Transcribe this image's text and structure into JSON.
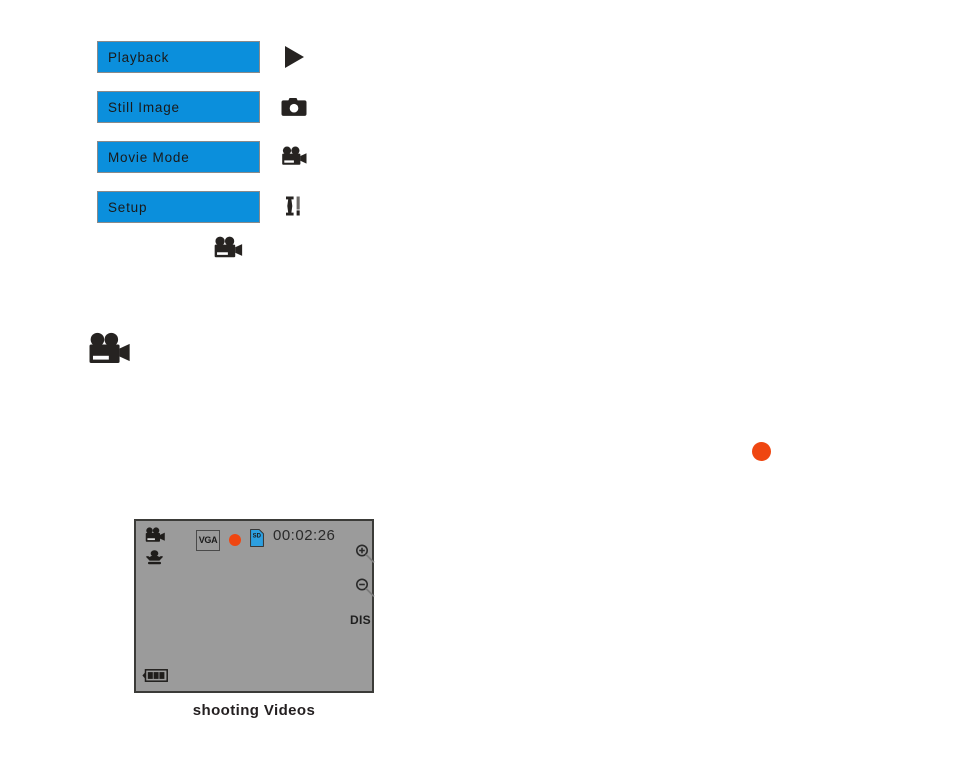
{
  "mode_menu": {
    "items": [
      {
        "label": "Playback",
        "icon": "play-triangle-icon"
      },
      {
        "label": "Still Image",
        "icon": "still-camera-icon"
      },
      {
        "label": "Movie Mode",
        "icon": "camcorder-icon"
      },
      {
        "label": "Setup",
        "icon": "tools-wrench-icon"
      }
    ],
    "trailing_icon": "camcorder-icon"
  },
  "large_icon": {
    "name": "camcorder-icon"
  },
  "record_indicator": {
    "name": "record-dot",
    "color": "#ef4611"
  },
  "lcd": {
    "mode_icon": "camcorder-icon",
    "macro_icon": "macro-flower-icon",
    "quality_badge": "VGA",
    "record_dot": "record-dot",
    "record_dot_color": "#ef4611",
    "sd_card_badge": "SD",
    "sd_card_color": "#2d9fe0",
    "timer": "00:02:26",
    "zoom_in_icon": "zoom-in-magnifier-icon",
    "zoom_out_icon": "zoom-out-magnifier-icon",
    "dis_label": "DIS",
    "battery_icon": "battery-icon",
    "battery_bars": 3,
    "screen_color": "#9b9b9b",
    "caption": "shooting Videos"
  },
  "colors": {
    "menu_button_blue": "#0b8fdc",
    "menu_button_border": "#8a8a8a",
    "icon_dark": "#262321"
  }
}
